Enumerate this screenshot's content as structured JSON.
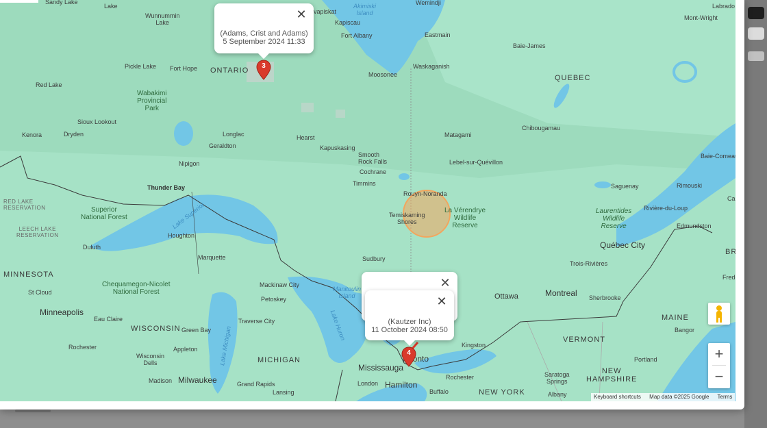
{
  "map": {
    "labels": {
      "sandy_lake": "Sandy Lake",
      "lake": "Lake",
      "wunnummin_lake": "Wunnummin\nLake",
      "pickle_lake": "Pickle Lake",
      "fort_hope": "Fort Hope",
      "ontario": "ONTARIO",
      "red_lake": "Red Lake",
      "wabakimi": "Wabakimi\nProvincial\nPark",
      "sioux_lookout": "Sioux Lookout",
      "kenora": "Kenora",
      "dryden": "Dryden",
      "longlac": "Longlac",
      "geraldton": "Geraldton",
      "hearst": "Hearst",
      "kapuskasing": "Kapuskasing",
      "smooth_rock_falls": "Smooth\nRock Falls",
      "cochrane": "Cochrane",
      "nipigon": "Nipigon",
      "thunder_bay": "Thunder Bay",
      "red_lake_reservation": "RED LAKE\nRESERVATION",
      "superior_forest": "Superior\nNational Forest",
      "leech_lake": "LEECH LAKE\nRESERVATION",
      "lake_superior": "Lake Superior",
      "houghton": "Houghton",
      "duluth": "Duluth",
      "marquette": "Marquette",
      "minnesota": "MINNESOTA",
      "chequamegon": "Chequamegon-Nicolet\nNational Forest",
      "st_cloud": "St Cloud",
      "minneapolis": "Minneapolis",
      "eau_claire": "Eau Claire",
      "wisconsin": "WISCONSIN",
      "green_bay": "Green Bay",
      "rochester_mn": "Rochester",
      "appleton": "Appleton",
      "wisconsin_dells": "Wisconsin\nDells",
      "madison": "Madison",
      "milwaukee": "Milwaukee",
      "lake_michigan": "Lake Michigan",
      "traverse_city": "Traverse City",
      "michigan": "MICHIGAN",
      "grand_rapids": "Grand Rapids",
      "lansing": "Lansing",
      "mackinaw_city": "Mackinaw City",
      "petoskey": "Petoskey",
      "manitoulin": "Manitoulin\nIsland",
      "lake_huron": "Lake Huron",
      "sudbury": "Sudbury",
      "timmins": "Timmins",
      "rouyn_noranda": "Rouyn-Noranda",
      "temiskaming": "Temiskaming\nShores",
      "la_verendrye": "La Vérendrye\nWildlife\nReserve",
      "akimiski": "Akimiski\nIsland",
      "wemindji": "Wemindji",
      "kapiscau": "Kapiscau",
      "attawapiskat": "vapiskat",
      "fort_albany": "Fort Albany",
      "eastmain": "Eastmain",
      "moosonee": "Moosonee",
      "waskaganish": "Waskaganish",
      "baie_james": "Baie-James",
      "quebec": "QUEBEC",
      "matagami": "Matagami",
      "chibougamau": "Chibougamau",
      "lebel": "Lebel-sur-Quévillon",
      "labrador": "Labrado",
      "mont_wright": "Mont-Wright",
      "baie_comeau": "Baie-Comeau",
      "saguenay": "Saguenay",
      "rimouski": "Rimouski",
      "laurentides": "Laurentides\nWildlife\nReserve",
      "riviere_du_loup": "Rivière-du-Loup",
      "edmundston": "Edmundston",
      "quebec_city": "Québec City",
      "trois_rivieres": "Trois-Rivières",
      "montreal": "Montreal",
      "sherbrooke": "Sherbrooke",
      "ottawa": "Ottawa",
      "maine": "MAINE",
      "bangor": "Bangor",
      "vermont": "VERMONT",
      "new_hampshire": "NEW\nHAMPSHIRE",
      "portland": "Portland",
      "kingston": "Kingston",
      "toronto": "Toronto",
      "mississauga": "Mississauga",
      "hamilton": "Hamilton",
      "london": "London",
      "rochester_ny": "Rochester",
      "buffalo": "Buffalo",
      "new_york": "NEW YORK",
      "albany": "Albany",
      "saratoga": "Saratoga\nSprings",
      "fredericton": "Frede",
      "ca": "Ca",
      "br": "BR"
    },
    "popups": [
      {
        "company": "(Adams, Crist and Adams)",
        "datetime": "5 September 2024 11:33",
        "close": "✕"
      },
      {
        "company": "(Kautzer Inc)",
        "datetime": "11 October 2024 08:50",
        "close": "✕"
      },
      {
        "close": "✕"
      }
    ],
    "markers": [
      {
        "label": "3",
        "color": "#d93a2b"
      },
      {
        "label": "4",
        "color": "#d93a2b"
      }
    ],
    "circle_color": "#f2a65e",
    "controls": {
      "zoom_in": "+",
      "zoom_out": "−",
      "pegman": "pegman-icon"
    },
    "attribution": {
      "shortcuts": "Keyboard shortcuts",
      "data": "Map data ©2025 Google",
      "terms": "Terms"
    }
  }
}
